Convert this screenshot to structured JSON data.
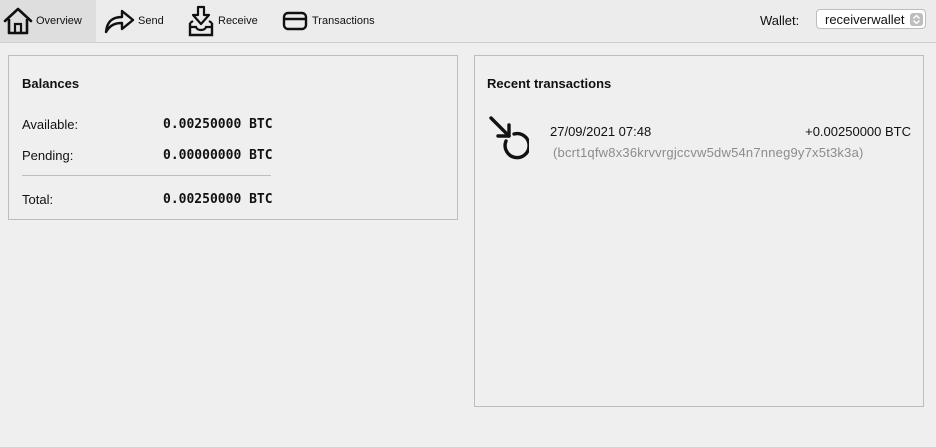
{
  "toolbar": {
    "tabs": [
      {
        "label": "Overview",
        "icon": "house-icon",
        "active": true
      },
      {
        "label": "Send",
        "icon": "send-arrow-icon",
        "active": false
      },
      {
        "label": "Receive",
        "icon": "receive-inbox-icon",
        "active": false
      },
      {
        "label": "Transactions",
        "icon": "card-icon",
        "active": false
      }
    ],
    "wallet_label": "Wallet:",
    "wallet_value": "receiverwallet"
  },
  "balances": {
    "title": "Balances",
    "available_label": "Available:",
    "available_value": "0.00250000 BTC",
    "pending_label": "Pending:",
    "pending_value": "0.00000000 BTC",
    "total_label": "Total:",
    "total_value": "0.00250000 BTC"
  },
  "recent": {
    "title": "Recent transactions",
    "items": [
      {
        "date": "27/09/2021 07:48",
        "amount": "+0.00250000 BTC",
        "address": "(bcrt1qfw8x36krvvrgjccvw5dw54n7nneg9y7x5t3k3a)",
        "icon": "receive-transaction-icon"
      }
    ]
  }
}
